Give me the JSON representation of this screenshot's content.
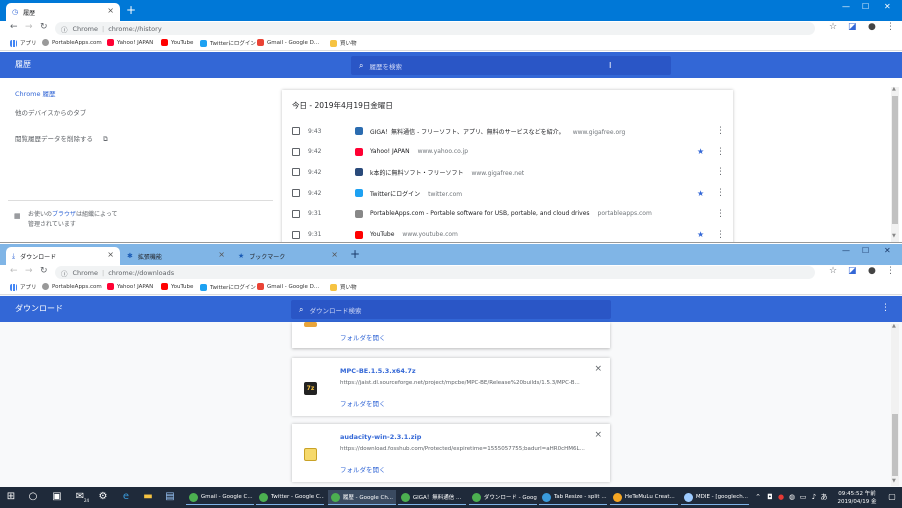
{
  "colors": {
    "chrome_blue": "#0078d7",
    "inactive_blue": "#80b5e6",
    "header_blue": "#3367d6",
    "search_blue": "#2a56c6",
    "link_blue": "#3367d6",
    "taskbar": "#1f2a3a"
  },
  "bookmarks": [
    {
      "label": "アプリ",
      "icon": "apps-grid-icon"
    },
    {
      "label": "PortableApps.com",
      "icon": "portableapps-icon"
    },
    {
      "label": "Yahoo! JAPAN",
      "icon": "yahoo-icon"
    },
    {
      "label": "YouTube",
      "icon": "youtube-icon"
    },
    {
      "label": "Twitterにログイン",
      "icon": "twitter-icon"
    },
    {
      "label": "Gmail - Google D...",
      "icon": "gmail-icon"
    },
    {
      "label": "買い物",
      "icon": "folder-icon"
    }
  ],
  "history_window": {
    "tab_title": "履歴",
    "omnibox": {
      "prefix": "Chrome",
      "url": "chrome://history"
    },
    "header_title": "履歴",
    "search_placeholder": "履歴を検索",
    "sidebar": {
      "active": "Chrome 履歴",
      "other_devices": "他のデバイスからのタブ",
      "clear_data": "閲覧履歴データを削除する",
      "managed_prefix": "お使いの",
      "managed_link": "ブラウザ",
      "managed_mid": "は組織によって",
      "managed_link2": "管理",
      "managed_suffix": "されています"
    },
    "date_header": "今日 - 2019年4月19日金曜日",
    "rows": [
      {
        "time": "9:43",
        "title": "GIGA！無料通信 - フリーソフト、アプリ、無料のサービスなどを紹介。",
        "domain": "www.gigafree.org",
        "starred": false,
        "icon": "gigafree-icon",
        "color": "#2b6cb0"
      },
      {
        "time": "9:42",
        "title": "Yahoo! JAPAN",
        "domain": "www.yahoo.co.jp",
        "starred": true,
        "icon": "yahoo-icon",
        "color": "#ff0033"
      },
      {
        "time": "9:42",
        "title": "k本的に無料ソフト・フリーソフト",
        "domain": "www.gigafree.net",
        "starred": false,
        "icon": "gigafree-net-icon",
        "color": "#2a4a7a"
      },
      {
        "time": "9:42",
        "title": "Twitterにログイン",
        "domain": "twitter.com",
        "starred": true,
        "icon": "twitter-icon",
        "color": "#1da1f2"
      },
      {
        "time": "9:31",
        "title": "PortableApps.com - Portable software for USB, portable, and cloud drives",
        "domain": "portableapps.com",
        "starred": false,
        "icon": "portableapps-icon",
        "color": "#888888"
      },
      {
        "time": "9:31",
        "title": "YouTube",
        "domain": "www.youtube.com",
        "starred": true,
        "icon": "youtube-icon",
        "color": "#ff0000"
      }
    ]
  },
  "downloads_window": {
    "tabs": [
      {
        "title": "ダウンロード",
        "active": true
      },
      {
        "title": "拡張機能",
        "active": false
      },
      {
        "title": "ブックマーク",
        "active": false
      }
    ],
    "omnibox": {
      "prefix": "Chrome",
      "url": "chrome://downloads"
    },
    "header_title": "ダウンロード",
    "search_placeholder": "ダウンロード検索",
    "partial_open_label": "フォルダを開く",
    "items": [
      {
        "name": "MPC-BE.1.5.3.x64.7z",
        "url": "https://jaist.dl.sourceforge.net/project/mpcbe/MPC-BE/Release%20builds/1.5.3/MPC-B...",
        "open_label": "フォルダを開く",
        "icon": "7z-archive-icon"
      },
      {
        "name": "audacity-win-2.3.1.zip",
        "url": "https://download.fosshub.com/Protected/expiretime=1555057755;badurl=aHR0cHM6L...",
        "open_label": "フォルダを開く",
        "icon": "zip-archive-icon"
      }
    ]
  },
  "taskbar": {
    "apps": [
      {
        "label": "Gmail - Google C...",
        "icon": "chrome-icon"
      },
      {
        "label": "Twitter - Google C...",
        "icon": "chrome-icon"
      },
      {
        "label": "履歴 - Google Ch...",
        "icon": "chrome-icon"
      },
      {
        "label": "GIGA！無料通信 ...",
        "icon": "chrome-icon"
      },
      {
        "label": "ダウンロード - Goog...",
        "icon": "chrome-icon"
      },
      {
        "label": "Tab Resize - split ...",
        "icon": "tab-resize-icon"
      },
      {
        "label": "HeTeMuLu Creat...",
        "icon": "hetemulu-icon"
      },
      {
        "label": "MDIE - [googlech...",
        "icon": "mdie-icon"
      }
    ],
    "time": "09:45:52 午前",
    "date": "2019/04/19 金",
    "ime": "あ",
    "mail_badge": "24"
  }
}
